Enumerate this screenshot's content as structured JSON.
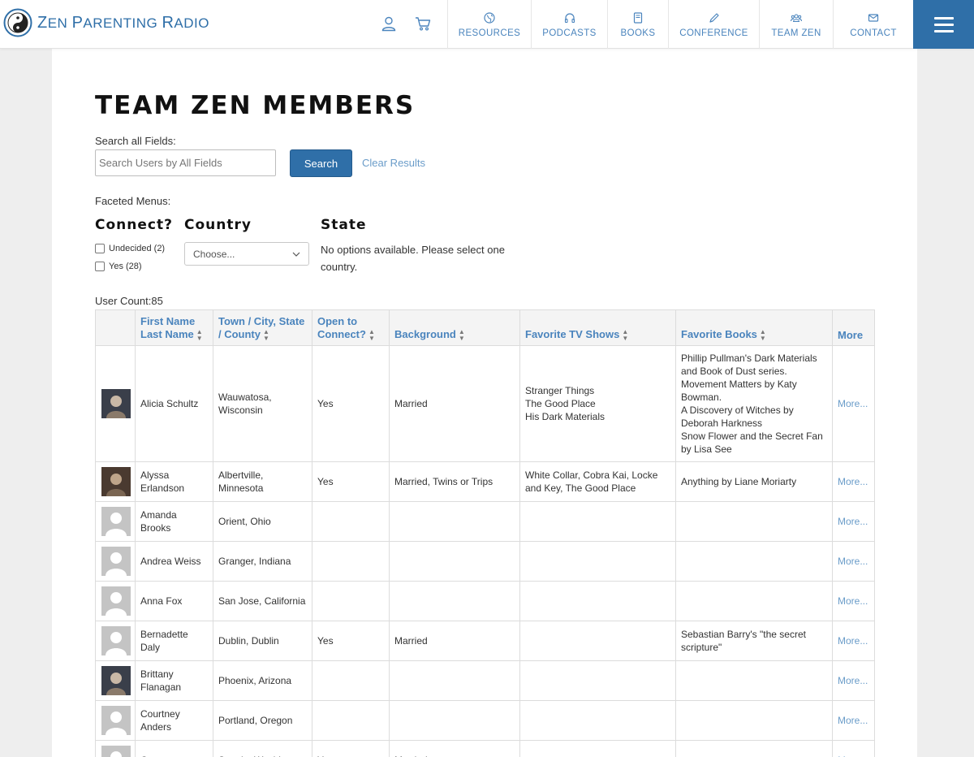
{
  "site": {
    "title_first": "Z",
    "title_rest": "EN ",
    "title_second": "P",
    "title_rest2": "ARENTING ",
    "title_third": "R",
    "title_rest3": "ADIO",
    "brand_color": "#2f6fa8"
  },
  "nav": {
    "items": [
      {
        "label": "RESOURCES",
        "icon": "globe-icon"
      },
      {
        "label": "PODCASTS",
        "icon": "headphones-icon"
      },
      {
        "label": "BOOKS",
        "icon": "book-icon"
      },
      {
        "label": "CONFERENCE",
        "icon": "pen-icon"
      },
      {
        "label": "TEAM ZEN",
        "icon": "users-icon"
      },
      {
        "label": "CONTACT",
        "icon": "envelope-icon"
      }
    ]
  },
  "page": {
    "title": "TEAM ZEN MEMBERS",
    "search_label": "Search all Fields:",
    "search_placeholder": "Search Users by All Fields",
    "search_button": "Search",
    "clear_results": "Clear Results",
    "faceted_label": "Faceted Menus:",
    "facet_connect": "Connect?",
    "facet_country": "Country",
    "facet_state": "State",
    "connect_options": [
      {
        "label": "Undecided (2)"
      },
      {
        "label": "Yes (28)"
      }
    ],
    "country_selected": "Choose...",
    "state_message": "No options available. Please select one country.",
    "user_count": "User Count:85"
  },
  "table": {
    "headers": {
      "name": "First Name Last Name",
      "town": "Town / City, State / County",
      "connect": "Open to Connect?",
      "background": "Background",
      "tv": "Favorite TV Shows",
      "books": "Favorite Books",
      "more": "More"
    },
    "rows": [
      {
        "name": "Alicia Schultz",
        "town": "Wauwatosa, Wisconsin",
        "connect": "Yes",
        "background": "Married",
        "tv": [
          "Stranger Things",
          "The Good Place",
          "His Dark Materials"
        ],
        "books": [
          "Phillip Pullman's Dark Materials and Book of Dust series.",
          "Movement Matters by Katy Bowman.",
          "A Discovery of Witches by Deborah Harkness",
          "Snow Flower and the Secret Fan by Lisa See"
        ],
        "more": "More...",
        "photo": "photo"
      },
      {
        "name": "Alyssa Erlandson",
        "town": "Albertville, Minnesota",
        "connect": "Yes",
        "background": "Married, Twins or Trips",
        "tv": [
          "White Collar, Cobra Kai, Locke and Key, The Good Place"
        ],
        "books": [
          "Anything by Liane Moriarty"
        ],
        "more": "More...",
        "photo": "photo"
      },
      {
        "name": "Amanda Brooks",
        "town": "Orient, Ohio",
        "connect": "",
        "background": "",
        "tv": [],
        "books": [],
        "more": "More...",
        "photo": "placeholder"
      },
      {
        "name": "Andrea Weiss",
        "town": "Granger, Indiana",
        "connect": "",
        "background": "",
        "tv": [],
        "books": [],
        "more": "More...",
        "photo": "placeholder"
      },
      {
        "name": "Anna Fox",
        "town": "San Jose, California",
        "connect": "",
        "background": "",
        "tv": [],
        "books": [],
        "more": "More...",
        "photo": "placeholder"
      },
      {
        "name": "Bernadette Daly",
        "town": "Dublin, Dublin",
        "connect": "Yes",
        "background": "Married",
        "tv": [],
        "books": [
          "Sebastian Barry's \"the secret scripture\""
        ],
        "more": "More...",
        "photo": "placeholder"
      },
      {
        "name": "Brittany Flanagan",
        "town": "Phoenix, Arizona",
        "connect": "",
        "background": "",
        "tv": [],
        "books": [],
        "more": "More...",
        "photo": "photo"
      },
      {
        "name": "Courtney Anders",
        "town": "Portland, Oregon",
        "connect": "",
        "background": "",
        "tv": [],
        "books": [],
        "more": "More...",
        "photo": "placeholder"
      },
      {
        "name": "Cara",
        "town": "Seattle, Washington",
        "connect": "Yes",
        "background": "Married",
        "tv": [],
        "books": [],
        "more": "More...",
        "photo": "placeholder"
      }
    ]
  }
}
